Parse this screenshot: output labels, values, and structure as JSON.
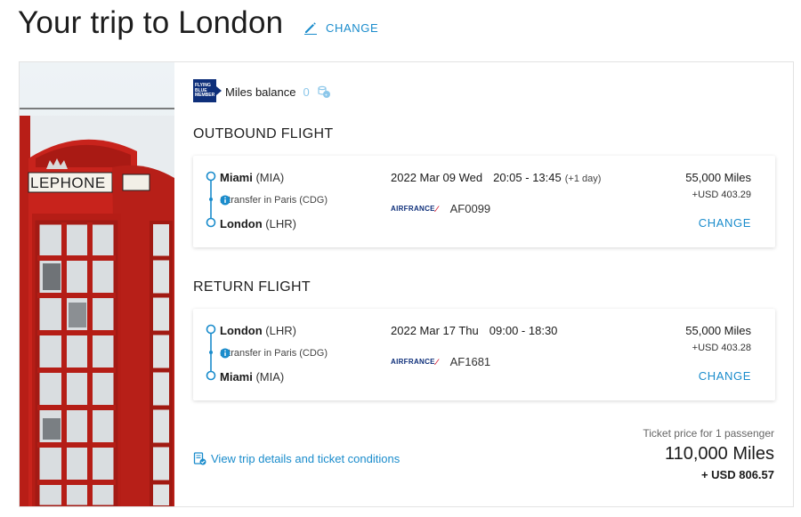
{
  "header": {
    "title": "Your trip to London",
    "change_label": "CHANGE"
  },
  "logo_text": [
    "FLYING",
    "BLUE",
    "MEMBER"
  ],
  "miles_balance": {
    "label": "Miles balance",
    "value": "0"
  },
  "outbound": {
    "section_title": "OUTBOUND FLIGHT",
    "from_city": "Miami",
    "from_code": "(MIA)",
    "transfer": "1 transfer in Paris (CDG)",
    "to_city": "London",
    "to_code": "(LHR)",
    "date": "2022 Mar 09 Wed",
    "time": "20:05 - 13:45",
    "plus_day": "(+1 day)",
    "airline": "AIRFRANCE",
    "flight_number": "AF0099",
    "miles": "55,000 Miles",
    "usd": "+USD 403.29",
    "change_label": "CHANGE"
  },
  "return": {
    "section_title": "RETURN FLIGHT",
    "from_city": "London",
    "from_code": "(LHR)",
    "transfer": "1 transfer in Paris (CDG)",
    "to_city": "Miami",
    "to_code": "(MIA)",
    "date": "2022 Mar 17 Thu",
    "time": "09:00 - 18:30",
    "airline": "AIRFRANCE",
    "flight_number": "AF1681",
    "miles": "55,000 Miles",
    "usd": "+USD 403.28",
    "change_label": "CHANGE"
  },
  "details_link": "View trip details and ticket conditions",
  "total": {
    "label": "Ticket price for 1 passenger",
    "miles": "110,000 Miles",
    "usd": "+ USD 806.57"
  },
  "photo": {
    "booth_sign": "LEPHONE"
  },
  "colors": {
    "accent": "#1a8ccc",
    "brand_navy": "#0e2f7a",
    "booth_red": "#c8231c"
  }
}
